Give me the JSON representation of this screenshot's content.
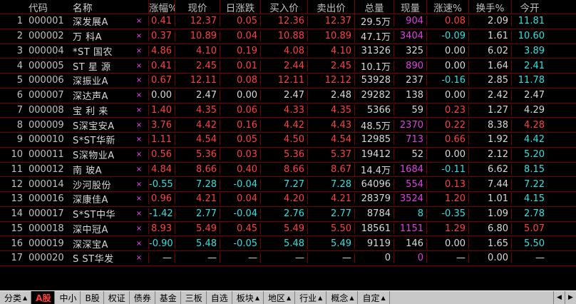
{
  "headers": [
    "",
    "代码",
    "名称",
    "",
    "涨幅%",
    "现价",
    "日涨跌",
    "买入价",
    "卖出价",
    "总量",
    "现量",
    "涨速%",
    "换手%",
    "今开"
  ],
  "rows": [
    {
      "idx": "1",
      "code": "000001",
      "name": "深发展A",
      "chg_pct": "0.41",
      "price": "12.37",
      "chg": "0.05",
      "bid": "12.36",
      "ask": "12.37",
      "vol": "29.5万",
      "cur": "904",
      "speed": "0.08",
      "turn": "2.09",
      "open": "11.81",
      "dir": "up",
      "cur_dir": "up",
      "speed_dir": "up",
      "open_dir": "dn"
    },
    {
      "idx": "2",
      "code": "000002",
      "name": "万 科A",
      "chg_pct": "0.37",
      "price": "10.89",
      "chg": "0.04",
      "bid": "10.88",
      "ask": "10.89",
      "vol": "47.1万",
      "cur": "3404",
      "speed": "-0.09",
      "turn": "1.61",
      "open": "10.60",
      "dir": "up",
      "cur_dir": "up",
      "speed_dir": "dn",
      "open_dir": "dn"
    },
    {
      "idx": "3",
      "code": "000004",
      "name": "*ST 国农",
      "chg_pct": "4.86",
      "price": "4.10",
      "chg": "0.19",
      "bid": "4.08",
      "ask": "4.10",
      "vol": "31326",
      "cur": "325",
      "speed": "0.00",
      "turn": "6.02",
      "open": "3.89",
      "dir": "up",
      "cur_dir": "eq",
      "speed_dir": "eq",
      "open_dir": "dn"
    },
    {
      "idx": "4",
      "code": "000005",
      "name": "ST 星 源",
      "chg_pct": "0.41",
      "price": "2.45",
      "chg": "0.01",
      "bid": "2.44",
      "ask": "2.45",
      "vol": "10.1万",
      "cur": "890",
      "speed": "0.00",
      "turn": "1.64",
      "open": "2.41",
      "dir": "up",
      "cur_dir": "up",
      "speed_dir": "eq",
      "open_dir": "dn"
    },
    {
      "idx": "5",
      "code": "000006",
      "name": "深振业A",
      "chg_pct": "0.67",
      "price": "12.11",
      "chg": "0.08",
      "bid": "12.11",
      "ask": "12.12",
      "vol": "53928",
      "cur": "237",
      "speed": "-0.16",
      "turn": "2.85",
      "open": "11.78",
      "dir": "up",
      "cur_dir": "eq",
      "speed_dir": "dn",
      "open_dir": "dn"
    },
    {
      "idx": "6",
      "code": "000007",
      "name": "深达声A",
      "chg_pct": "0.00",
      "price": "2.47",
      "chg": "0.00",
      "bid": "2.47",
      "ask": "2.48",
      "vol": "29282",
      "cur": "138",
      "speed": "0.00",
      "turn": "2.42",
      "open": "2.47",
      "dir": "eq",
      "cur_dir": "eq",
      "speed_dir": "eq",
      "open_dir": "eq"
    },
    {
      "idx": "7",
      "code": "000008",
      "name": "宝 利 来",
      "chg_pct": "1.40",
      "price": "4.35",
      "chg": "0.06",
      "bid": "4.33",
      "ask": "4.35",
      "vol": "5366",
      "cur": "59",
      "speed": "0.23",
      "turn": "1.27",
      "open": "4.29",
      "dir": "up",
      "cur_dir": "eq",
      "speed_dir": "up",
      "open_dir": "eq"
    },
    {
      "idx": "8",
      "code": "000009",
      "name": "S深宝安A",
      "chg_pct": "3.76",
      "price": "4.42",
      "chg": "0.16",
      "bid": "4.42",
      "ask": "4.43",
      "vol": "48.5万",
      "cur": "2370",
      "speed": "0.22",
      "turn": "8.38",
      "open": "4.28",
      "dir": "up",
      "cur_dir": "up",
      "speed_dir": "up",
      "open_dir": "up"
    },
    {
      "idx": "9",
      "code": "000010",
      "name": "S*ST华新",
      "chg_pct": "1.11",
      "price": "4.54",
      "chg": "0.05",
      "bid": "4.50",
      "ask": "4.54",
      "vol": "12985",
      "cur": "713",
      "speed": "0.66",
      "turn": "1.92",
      "open": "4.42",
      "dir": "up",
      "cur_dir": "up",
      "speed_dir": "up",
      "open_dir": "dn"
    },
    {
      "idx": "10",
      "code": "000011",
      "name": "S深物业A",
      "chg_pct": "0.56",
      "price": "5.36",
      "chg": "0.03",
      "bid": "5.36",
      "ask": "5.37",
      "vol": "19412",
      "cur": "52",
      "speed": "0.00",
      "turn": "2.12",
      "open": "5.20",
      "dir": "up",
      "cur_dir": "eq",
      "speed_dir": "eq",
      "open_dir": "dn"
    },
    {
      "idx": "11",
      "code": "000012",
      "name": "南 玻A",
      "chg_pct": "4.84",
      "price": "8.66",
      "chg": "0.40",
      "bid": "8.66",
      "ask": "8.67",
      "vol": "14.4万",
      "cur": "1684",
      "speed": "-0.11",
      "turn": "6.62",
      "open": "8.15",
      "dir": "up",
      "cur_dir": "up",
      "speed_dir": "dn",
      "open_dir": "dn"
    },
    {
      "idx": "12",
      "code": "000014",
      "name": "沙河股份",
      "chg_pct": "-0.55",
      "price": "7.28",
      "chg": "-0.04",
      "bid": "7.27",
      "ask": "7.28",
      "vol": "64096",
      "cur": "554",
      "speed": "0.13",
      "turn": "7.44",
      "open": "7.22",
      "dir": "dn",
      "cur_dir": "up",
      "speed_dir": "up",
      "open_dir": "dn"
    },
    {
      "idx": "13",
      "code": "000016",
      "name": "深康佳A",
      "chg_pct": "0.96",
      "price": "4.21",
      "chg": "0.04",
      "bid": "4.20",
      "ask": "4.21",
      "vol": "28379",
      "cur": "3524",
      "speed": "1.20",
      "turn": "1.01",
      "open": "4.15",
      "dir": "up",
      "cur_dir": "up",
      "speed_dir": "up",
      "open_dir": "dn"
    },
    {
      "idx": "14",
      "code": "000017",
      "name": "S*ST中华",
      "chg_pct": "-1.42",
      "price": "2.77",
      "chg": "-0.04",
      "bid": "2.76",
      "ask": "2.77",
      "vol": "8784",
      "cur": "8",
      "speed": "-0.35",
      "turn": "1.09",
      "open": "2.78",
      "dir": "dn",
      "cur_dir": "dn",
      "speed_dir": "dn",
      "open_dir": "dn"
    },
    {
      "idx": "15",
      "code": "000018",
      "name": "深中冠A",
      "chg_pct": "8.93",
      "price": "5.49",
      "chg": "0.45",
      "bid": "5.49",
      "ask": "5.50",
      "vol": "18561",
      "cur": "1151",
      "speed": "1.29",
      "turn": "6.80",
      "open": "5.07",
      "dir": "up",
      "cur_dir": "up",
      "speed_dir": "up",
      "open_dir": "up"
    },
    {
      "idx": "16",
      "code": "000019",
      "name": "深深宝A",
      "chg_pct": "-0.90",
      "price": "5.48",
      "chg": "-0.05",
      "bid": "5.48",
      "ask": "5.49",
      "vol": "9119",
      "cur": "146",
      "speed": "0.00",
      "turn": "1.65",
      "open": "5.50",
      "dir": "dn",
      "cur_dir": "eq",
      "speed_dir": "eq",
      "open_dir": "dn"
    },
    {
      "idx": "17",
      "code": "000020",
      "name": "S ST华发",
      "chg_pct": "—",
      "price": "—",
      "chg": "—",
      "bid": "—",
      "ask": "—",
      "vol": "0",
      "cur": "0",
      "speed": "—",
      "turn": "0.00",
      "open": "—",
      "dir": "eq",
      "cur_dir": "up",
      "speed_dir": "eq",
      "open_dir": "eq"
    }
  ],
  "mark": "×",
  "tabs": [
    {
      "label": "分类",
      "arrow": "▲",
      "active": false
    },
    {
      "label": "A股",
      "arrow": "",
      "active": true
    },
    {
      "label": "中小",
      "arrow": "",
      "active": false
    },
    {
      "label": "B股",
      "arrow": "",
      "active": false
    },
    {
      "label": "权证",
      "arrow": "",
      "active": false
    },
    {
      "label": "债券",
      "arrow": "",
      "active": false
    },
    {
      "label": "基金",
      "arrow": "",
      "active": false
    },
    {
      "label": "三板",
      "arrow": "",
      "active": false
    },
    {
      "label": "自选",
      "arrow": "",
      "active": false
    },
    {
      "label": "板块",
      "arrow": "▲",
      "active": false
    },
    {
      "label": "地区",
      "arrow": "▲",
      "active": false
    },
    {
      "label": "行业",
      "arrow": "▲",
      "active": false
    },
    {
      "label": "概念",
      "arrow": "▲",
      "active": false
    },
    {
      "label": "自定",
      "arrow": "▲",
      "active": false
    }
  ],
  "scroll_left": "◀",
  "scroll_right": "▶",
  "colors": {
    "up": "#ff4040",
    "down": "#30e0e0",
    "volume_up": "#e040e0",
    "grid": "#7a0000"
  }
}
